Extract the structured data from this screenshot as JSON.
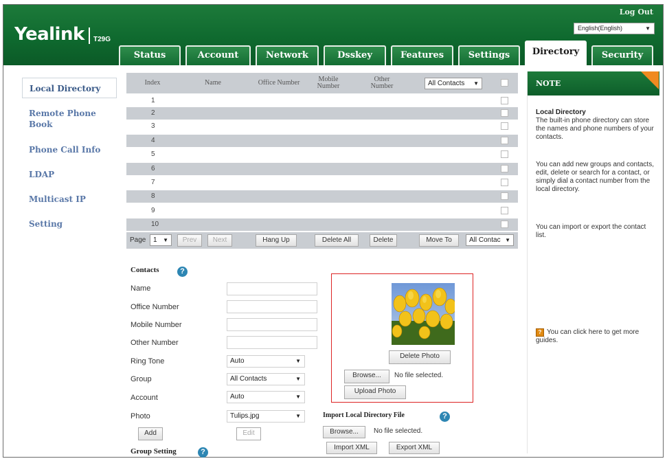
{
  "header": {
    "logo": "Yealink",
    "model": "T29G",
    "logout": "Log Out",
    "language": "English(English)"
  },
  "tabs": [
    "Status",
    "Account",
    "Network",
    "Dsskey",
    "Features",
    "Settings",
    "Directory",
    "Security"
  ],
  "active_tab": "Directory",
  "sidebar": {
    "items": [
      {
        "label": "Local Directory"
      },
      {
        "label": "Remote Phone Book"
      },
      {
        "label": "Phone Call Info"
      },
      {
        "label": "LDAP"
      },
      {
        "label": "Multicast IP"
      },
      {
        "label": "Setting"
      }
    ]
  },
  "table": {
    "headers": {
      "index": "Index",
      "name": "Name",
      "office": "Office Number",
      "mobile": "Mobile Number",
      "other": "Other Number"
    },
    "group_filter": "All Contacts",
    "rows": [
      "1",
      "2",
      "3",
      "4",
      "5",
      "6",
      "7",
      "8",
      "9",
      "10"
    ]
  },
  "pager": {
    "page_label": "Page",
    "page_value": "1",
    "prev": "Prev",
    "next": "Next",
    "hang_up": "Hang Up",
    "delete_all": "Delete All",
    "delete": "Delete",
    "move_to": "Move To",
    "move_target": "All Contac"
  },
  "contacts": {
    "title": "Contacts",
    "fields": {
      "name": "Name",
      "office": "Office Number",
      "mobile": "Mobile Number",
      "other": "Other Number",
      "ring_tone": "Ring Tone",
      "group": "Group",
      "account": "Account",
      "photo": "Photo"
    },
    "ring_tone_value": "Auto",
    "group_value": "All Contacts",
    "account_value": "Auto",
    "photo_value": "Tulips.jpg",
    "add": "Add",
    "edit": "Edit"
  },
  "photo_panel": {
    "delete_photo": "Delete Photo",
    "browse": "Browse...",
    "no_file": "No file selected.",
    "upload_photo": "Upload Photo"
  },
  "import": {
    "title": "Import Local Directory File",
    "browse": "Browse...",
    "no_file": "No file selected.",
    "import_xml": "Import XML",
    "export_xml": "Export XML"
  },
  "group_setting": {
    "title": "Group Setting"
  },
  "note": {
    "title": "NOTE",
    "heading": "Local Directory",
    "p1": "The built-in phone directory can store the names and phone numbers of your contacts.",
    "p2": "You can add new groups and contacts, edit, delete or search for a contact, or simply dial a contact number from the local directory.",
    "p3": "You can import or export the contact list.",
    "p4": "You can click here to get more guides."
  },
  "colors": {
    "header_green": "#0f6a2f",
    "note_accent": "#f08a20",
    "photo_border": "#d22222",
    "help_icon": "#2d86b3"
  }
}
